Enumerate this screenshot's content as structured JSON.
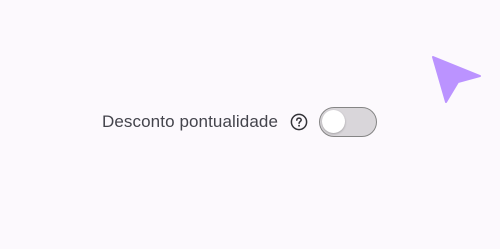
{
  "setting": {
    "label": "Desconto pontualidade",
    "help_icon": "help-circle-icon",
    "toggle_state": "off"
  },
  "colors": {
    "background": "#fcf9fd",
    "label_text": "#44444c",
    "toggle_track": "#d9d6da",
    "toggle_border": "#858585",
    "cursor": "#bb93ff"
  },
  "cursor": {
    "icon": "pointer-arrow-icon"
  }
}
